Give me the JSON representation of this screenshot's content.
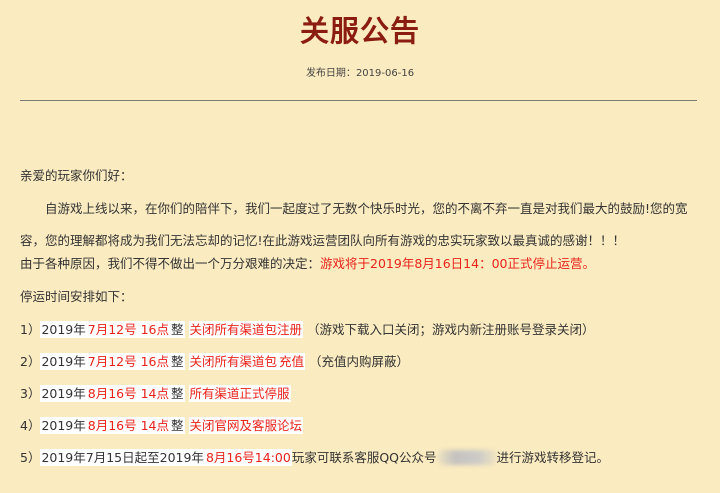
{
  "title": "关服公告",
  "publish": {
    "label": "发布日期：",
    "date": "2019-06-16"
  },
  "greeting": "亲爱的玩家你们好：",
  "thanks": "自游戏上线以来，在你们的陪伴下，我们一起度过了无数个快乐时光，您的不离不弃一直是对我们最大的鼓励!您的宽容，您的理解都将成为我们无法忘却的记忆!在此游戏运营团队向所有游戏的忠实玩家致以最真诚的感谢！！！",
  "decision": {
    "prefix": "由于各种原因，我们不得不做出一个万分艰难的决定：",
    "highlight": "游戏将于2019年8月16日14：00正式停止运营。"
  },
  "schedule_title": "停运时间安排如下：",
  "schedule": [
    {
      "num": "1）",
      "year": "2019年",
      "date": "7月12号 16点",
      "zheng": "整",
      "action": "关闭所有渠道包注册",
      "action_tail": "",
      "note": "（游戏下载入口关闭；游戏内新注册账号登录关闭）"
    },
    {
      "num": "2）",
      "year": "2019年",
      "date": "7月12号 16点",
      "zheng": "整",
      "action": "关闭所有渠道包",
      "action_tail": "充值",
      "note": "（充值内购屏蔽）"
    },
    {
      "num": "3）",
      "year": "2019年",
      "date": "8月16号 14点",
      "zheng": "整",
      "action": "所有渠道正式停服",
      "action_tail": "",
      "note": ""
    },
    {
      "num": "4）",
      "year": "2019年",
      "date": "8月16号 14点",
      "zheng": "整",
      "action": "关闭官网及客服论坛",
      "action_tail": "",
      "note": ""
    }
  ],
  "item5": {
    "num": "5）",
    "part1": "2019年7月15日起至2019年",
    "date": "8月16号14:00",
    "part2": "玩家可联系客服QQ公众号",
    "part3": "进行游戏转移登记。"
  },
  "colors": {
    "background": "#faebc0",
    "title": "#8b1c12",
    "highlight_red": "#e8231a",
    "text": "#333333"
  }
}
